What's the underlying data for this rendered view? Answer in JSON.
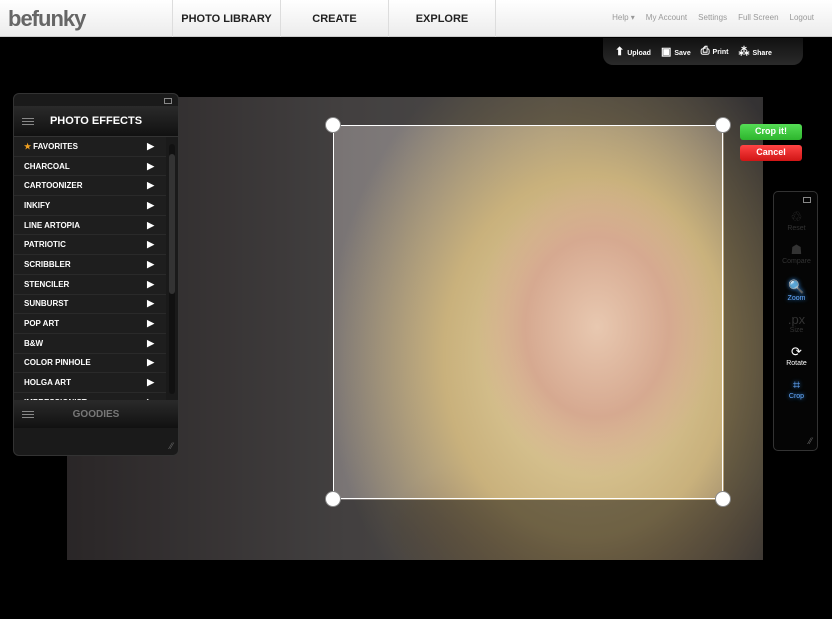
{
  "header": {
    "logo": "befunky",
    "nav": [
      "PHOTO LIBRARY",
      "CREATE",
      "EXPLORE"
    ],
    "links": [
      "Help ▾",
      "My Account",
      "Settings",
      "Full Screen",
      "Logout"
    ]
  },
  "toolbar": [
    {
      "icon": "upload-icon",
      "glyph": "⬆",
      "label": "Upload"
    },
    {
      "icon": "save-icon",
      "glyph": "▣",
      "label": "Save"
    },
    {
      "icon": "print-icon",
      "glyph": "⎙",
      "label": "Print"
    },
    {
      "icon": "share-icon",
      "glyph": "⁂",
      "label": "Share"
    }
  ],
  "crop": {
    "confirm": "Crop it!",
    "cancel": "Cancel",
    "confirm_color": "#2db52d",
    "cancel_color": "#d01515"
  },
  "effects_panel": {
    "title": "PHOTO EFFECTS",
    "items": [
      "FAVORITES",
      "CHARCOAL",
      "CARTOONIZER",
      "INKIFY",
      "LINE ARTOPIA",
      "PATRIOTIC",
      "SCRIBBLER",
      "STENCILER",
      "SUNBURST",
      "POP ART",
      "B&W",
      "COLOR PINHOLE",
      "HOLGA ART",
      "IMPRESSIONIST"
    ],
    "goodies": "GOODIES"
  },
  "side_tools": [
    {
      "icon": "reset-icon",
      "glyph": "♲",
      "label": "Reset",
      "state": "disabled"
    },
    {
      "icon": "compare-icon",
      "glyph": "☗",
      "label": "Compare",
      "state": "disabled"
    },
    {
      "icon": "zoom-icon",
      "glyph": "🔍",
      "label": "Zoom",
      "state": "active"
    },
    {
      "icon": "size-icon",
      "glyph": ".px",
      "label": "Size",
      "state": "disabled"
    },
    {
      "icon": "rotate-icon",
      "glyph": "⟳",
      "label": "Rotate",
      "state": "enabled"
    },
    {
      "icon": "crop-icon",
      "glyph": "⌗",
      "label": "Crop",
      "state": "active"
    }
  ]
}
